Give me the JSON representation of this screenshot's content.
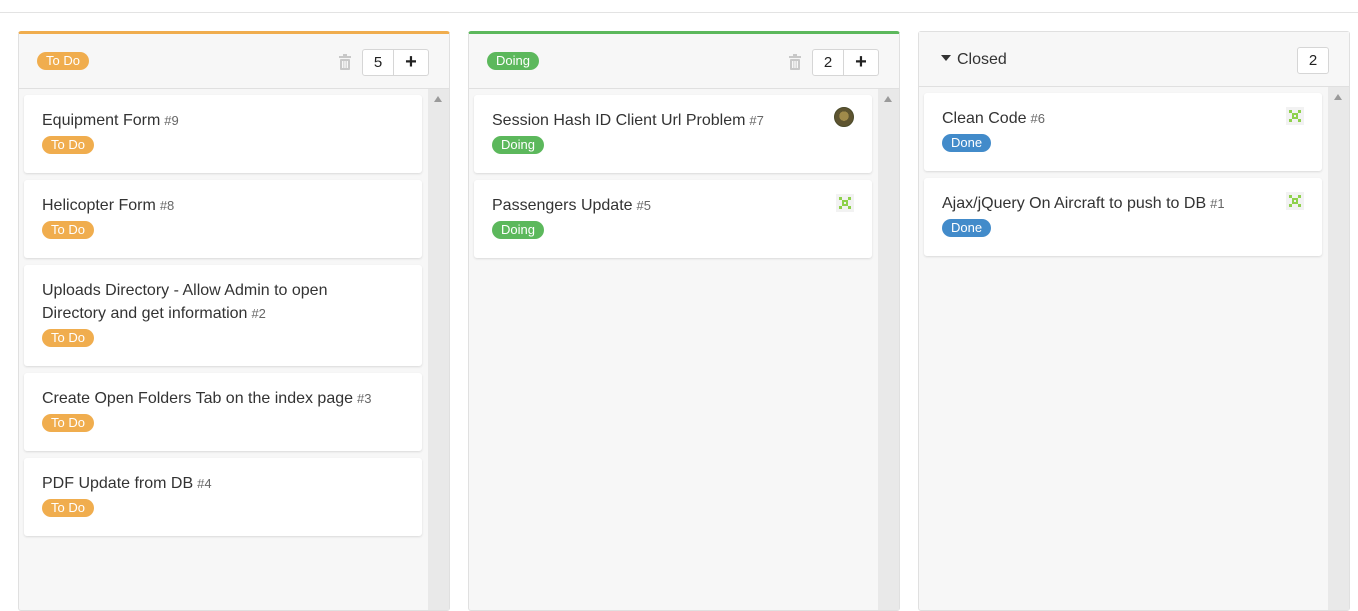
{
  "columns": [
    {
      "name": "To Do",
      "label_color": "#f0ad4e",
      "top_border_color": "#f0ad4e",
      "count": "5",
      "add_label": "+",
      "cards": [
        {
          "title": "Equipment Form",
          "number": "#9",
          "label": "To Do"
        },
        {
          "title": "Helicopter Form",
          "number": "#8",
          "label": "To Do"
        },
        {
          "title": "Uploads Directory - Allow Admin to open Directory and get information",
          "number": "#2",
          "label": "To Do"
        },
        {
          "title": "Create Open Folders Tab on the index page",
          "number": "#3",
          "label": "To Do"
        },
        {
          "title": "PDF Update from DB",
          "number": "#4",
          "label": "To Do"
        }
      ]
    },
    {
      "name": "Doing",
      "label_color": "#5cb85c",
      "top_border_color": "#5cb85c",
      "count": "2",
      "add_label": "+",
      "cards": [
        {
          "title": "Session Hash ID Client Url Problem",
          "number": "#7",
          "label": "Doing",
          "assignee": "avatar-photo"
        },
        {
          "title": "Passengers Update",
          "number": "#5",
          "label": "Doing",
          "assignee": "identicon-green"
        }
      ]
    },
    {
      "name": "Closed",
      "count": "2",
      "cards": [
        {
          "title": "Clean Code",
          "number": "#6",
          "label": "Done",
          "label_color": "#428bca",
          "assignee": "identicon-green"
        },
        {
          "title": "Ajax/jQuery On Aircraft to push to DB",
          "number": "#1",
          "label": "Done",
          "label_color": "#428bca",
          "assignee": "identicon-green"
        }
      ]
    }
  ]
}
